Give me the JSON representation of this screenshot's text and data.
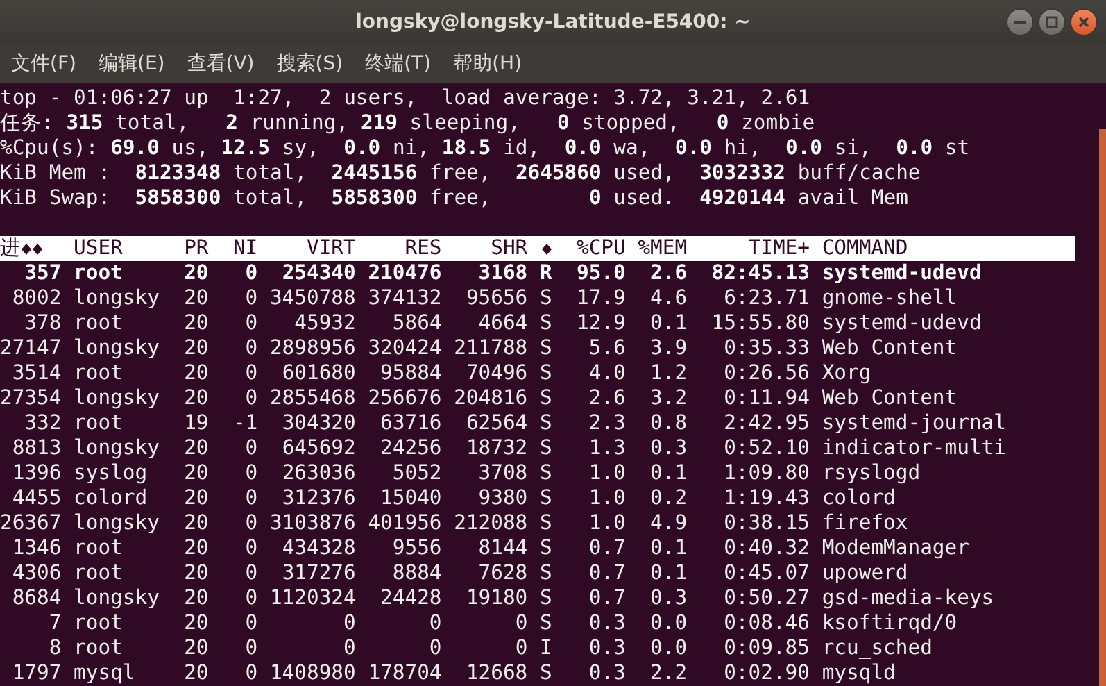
{
  "window": {
    "title": "longsky@longsky-Latitude-E5400: ~"
  },
  "menu": [
    "文件(F)",
    "编辑(E)",
    "查看(V)",
    "搜索(S)",
    "终端(T)",
    "帮助(H)"
  ],
  "summary": [
    "top - 01:06:27 up  1:27,  2 users,  load average: 3.72, 3.21, 2.61",
    "任务: **315** total,   **2** running, **219** sleeping,   **0** stopped,   **0** zombie",
    "%Cpu(s): **69.0** us, **12.5** sy,  **0.0** ni, **18.5** id,  **0.0** wa,  **0.0** hi,  **0.0** si,  **0.0** st",
    "KiB Mem :  **8123348** total,  **2445156** free,  **2645860** used,  **3032332** buff/cache",
    "KiB Swap:  **5858300** total,  **5858300** free,        **0** used.  **4920144** avail Mem"
  ],
  "table": {
    "columns": [
      {
        "kind": "text",
        "label": "进",
        "trailing_marks": true
      },
      {
        "kind": "text",
        "label": "USER"
      },
      {
        "kind": "text",
        "label": "PR"
      },
      {
        "kind": "text",
        "label": "NI"
      },
      {
        "kind": "text",
        "label": "VIRT"
      },
      {
        "kind": "text",
        "label": "RES"
      },
      {
        "kind": "text",
        "label": "SHR"
      },
      {
        "kind": "mark"
      },
      {
        "kind": "text",
        "label": "%CPU"
      },
      {
        "kind": "text",
        "label": "%MEM"
      },
      {
        "kind": "text",
        "label": "TIME+"
      },
      {
        "kind": "text",
        "label": "COMMAND"
      }
    ],
    "rows": [
      {
        "highlighted": true,
        "cells": [
          "357",
          "root",
          "20",
          "0",
          "254340",
          "210476",
          "3168",
          "R",
          "95.0",
          "2.6",
          "82:45.13",
          "systemd-udevd"
        ]
      },
      {
        "highlighted": false,
        "cells": [
          "8002",
          "longsky",
          "20",
          "0",
          "3450788",
          "374132",
          "95656",
          "S",
          "17.9",
          "4.6",
          "6:23.71",
          "gnome-shell"
        ]
      },
      {
        "highlighted": false,
        "cells": [
          "378",
          "root",
          "20",
          "0",
          "45932",
          "5864",
          "4664",
          "S",
          "12.9",
          "0.1",
          "15:55.80",
          "systemd-udevd"
        ]
      },
      {
        "highlighted": false,
        "cells": [
          "27147",
          "longsky",
          "20",
          "0",
          "2898956",
          "320424",
          "211788",
          "S",
          "5.6",
          "3.9",
          "0:35.33",
          "Web Content"
        ]
      },
      {
        "highlighted": false,
        "cells": [
          "3514",
          "root",
          "20",
          "0",
          "601680",
          "95884",
          "70496",
          "S",
          "4.0",
          "1.2",
          "0:26.56",
          "Xorg"
        ]
      },
      {
        "highlighted": false,
        "cells": [
          "27354",
          "longsky",
          "20",
          "0",
          "2855468",
          "256676",
          "204816",
          "S",
          "2.6",
          "3.2",
          "0:11.94",
          "Web Content"
        ]
      },
      {
        "highlighted": false,
        "cells": [
          "332",
          "root",
          "19",
          "-1",
          "304320",
          "63716",
          "62564",
          "S",
          "2.3",
          "0.8",
          "2:42.95",
          "systemd-journal"
        ]
      },
      {
        "highlighted": false,
        "cells": [
          "8813",
          "longsky",
          "20",
          "0",
          "645692",
          "24256",
          "18732",
          "S",
          "1.3",
          "0.3",
          "0:52.10",
          "indicator-multi"
        ]
      },
      {
        "highlighted": false,
        "cells": [
          "1396",
          "syslog",
          "20",
          "0",
          "263036",
          "5052",
          "3708",
          "S",
          "1.0",
          "0.1",
          "1:09.80",
          "rsyslogd"
        ]
      },
      {
        "highlighted": false,
        "cells": [
          "4455",
          "colord",
          "20",
          "0",
          "312376",
          "15040",
          "9380",
          "S",
          "1.0",
          "0.2",
          "1:19.43",
          "colord"
        ]
      },
      {
        "highlighted": false,
        "cells": [
          "26367",
          "longsky",
          "20",
          "0",
          "3103876",
          "401956",
          "212088",
          "S",
          "1.0",
          "4.9",
          "0:38.15",
          "firefox"
        ]
      },
      {
        "highlighted": false,
        "cells": [
          "1346",
          "root",
          "20",
          "0",
          "434328",
          "9556",
          "8144",
          "S",
          "0.7",
          "0.1",
          "0:40.32",
          "ModemManager"
        ]
      },
      {
        "highlighted": false,
        "cells": [
          "4306",
          "root",
          "20",
          "0",
          "317276",
          "8884",
          "7628",
          "S",
          "0.7",
          "0.1",
          "0:45.07",
          "upowerd"
        ]
      },
      {
        "highlighted": false,
        "cells": [
          "8684",
          "longsky",
          "20",
          "0",
          "1120324",
          "24428",
          "19180",
          "S",
          "0.7",
          "0.3",
          "0:50.27",
          "gsd-media-keys"
        ]
      },
      {
        "highlighted": false,
        "cells": [
          "7",
          "root",
          "20",
          "0",
          "0",
          "0",
          "0",
          "S",
          "0.3",
          "0.0",
          "0:08.46",
          "ksoftirqd/0"
        ]
      },
      {
        "highlighted": false,
        "cells": [
          "8",
          "root",
          "20",
          "0",
          "0",
          "0",
          "0",
          "I",
          "0.3",
          "0.0",
          "0:09.85",
          "rcu_sched"
        ]
      },
      {
        "highlighted": false,
        "cells": [
          "1797",
          "mysql",
          "20",
          "0",
          "1408980",
          "178704",
          "12668",
          "S",
          "0.3",
          "2.2",
          "0:02.90",
          "mysqld"
        ]
      }
    ]
  }
}
